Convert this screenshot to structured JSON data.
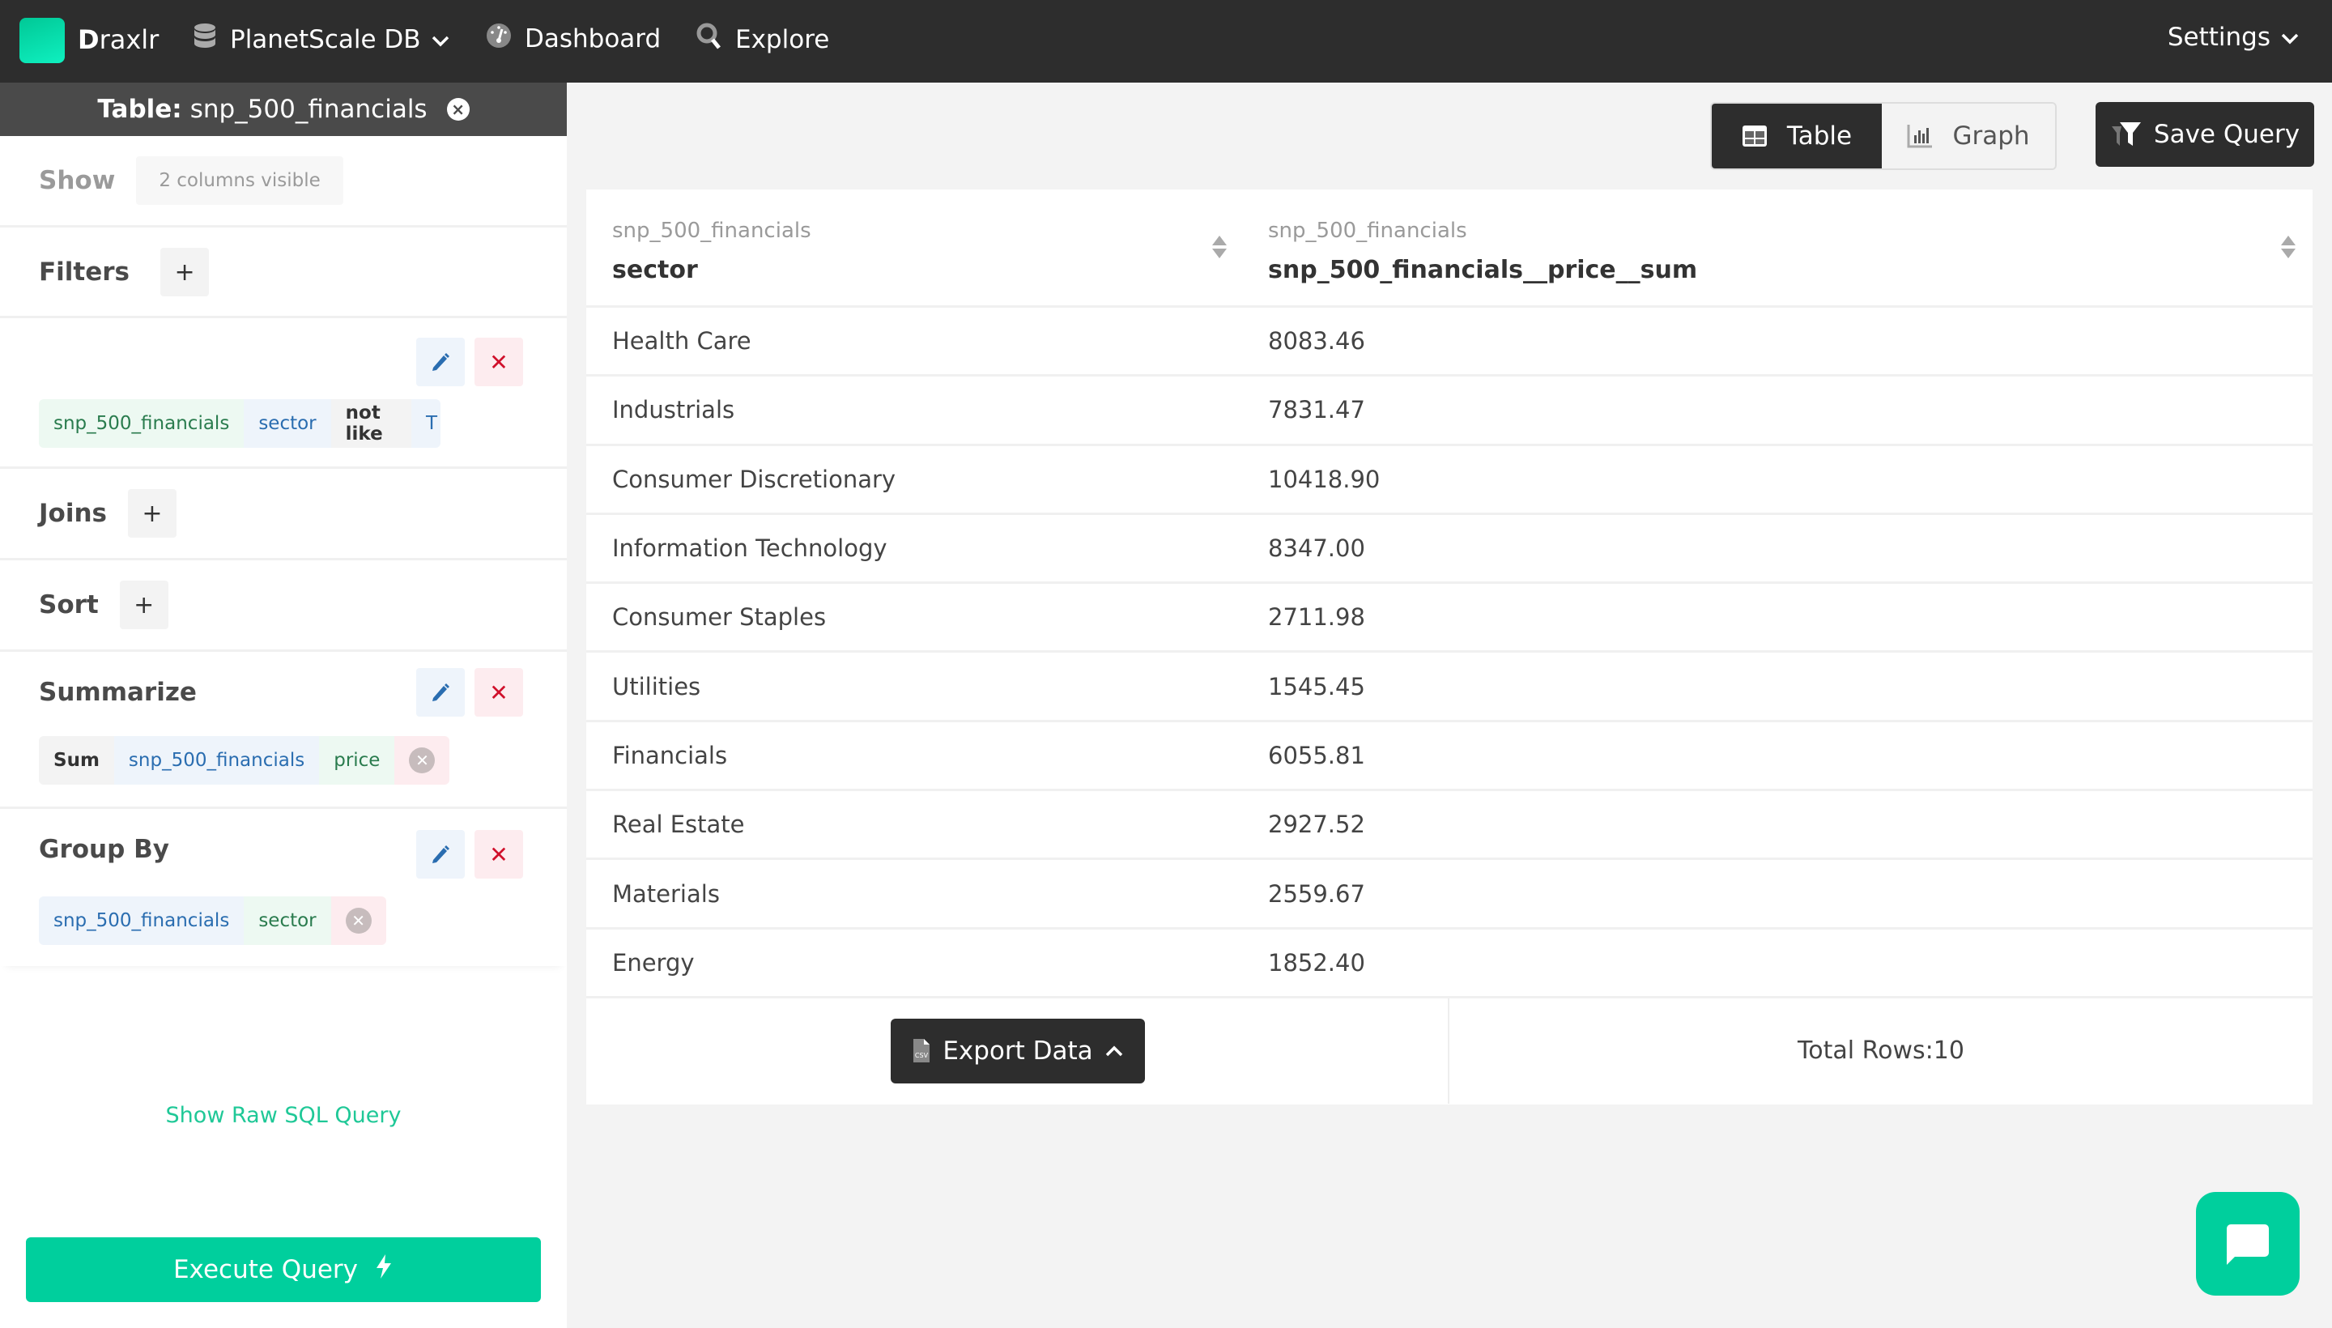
{
  "nav": {
    "brand": "Draxlr",
    "brand_initial": "D",
    "brand_rest": "raxlr",
    "database": "PlanetScale DB",
    "dashboard": "Dashboard",
    "explore": "Explore",
    "settings": "Settings"
  },
  "sidebar": {
    "table_label": "Table:",
    "table_name": "snp_500_financials",
    "show": {
      "title": "Show",
      "value": "2 columns visible"
    },
    "filters": {
      "title": "Filters",
      "add": "+",
      "condition": {
        "table": "snp_500_financials",
        "column": "sector",
        "operator": "not like",
        "value": "T"
      }
    },
    "joins": {
      "title": "Joins",
      "add": "+"
    },
    "sort": {
      "title": "Sort",
      "add": "+"
    },
    "summarize": {
      "title": "Summarize",
      "item": {
        "function": "Sum",
        "table": "snp_500_financials",
        "column": "price"
      }
    },
    "group_by": {
      "title": "Group By",
      "item": {
        "table": "snp_500_financials",
        "column": "sector"
      }
    },
    "show_sql": "Show Raw SQL Query",
    "execute": "Execute Query"
  },
  "toolbar": {
    "table": "Table",
    "graph": "Graph",
    "active_view": "Table",
    "save_query": "Save Query"
  },
  "table": {
    "columns": [
      {
        "table": "snp_500_financials",
        "name": "sector"
      },
      {
        "table": "snp_500_financials",
        "name": "snp_500_financials__price__sum"
      }
    ],
    "rows": [
      [
        "Health Care",
        "8083.46"
      ],
      [
        "Industrials",
        "7831.47"
      ],
      [
        "Consumer Discretionary",
        "10418.90"
      ],
      [
        "Information Technology",
        "8347.00"
      ],
      [
        "Consumer Staples",
        "2711.98"
      ],
      [
        "Utilities",
        "1545.45"
      ],
      [
        "Financials",
        "6055.81"
      ],
      [
        "Real Estate",
        "2927.52"
      ],
      [
        "Materials",
        "2559.67"
      ],
      [
        "Energy",
        "1852.40"
      ]
    ],
    "export": "Export Data",
    "total_rows": "Total Rows:10"
  },
  "colors": {
    "accent": "#00cf9d",
    "nav_bg": "#2d2d2d",
    "edit": "#2a6db0",
    "delete": "#d0102b"
  }
}
